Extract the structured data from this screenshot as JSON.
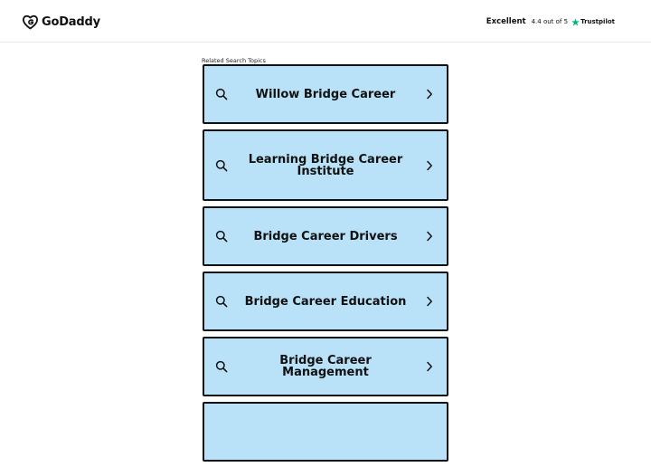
{
  "header": {
    "logo_text": "GoDaddy",
    "rating_word": "Excellent",
    "rating_score": "4.4 out of 5",
    "rating_provider": "Trustpilot",
    "star_color": "#00b67a"
  },
  "related": {
    "label": "Related Search Topics",
    "items": [
      {
        "label": "Willow Bridge Career"
      },
      {
        "label": "Learning Bridge Career Institute"
      },
      {
        "label": "Bridge Career Drivers"
      },
      {
        "label": "Bridge Career Education"
      },
      {
        "label": "Bridge Career Management"
      },
      {
        "label": ""
      }
    ]
  },
  "colors": {
    "card_background": "#b9e2f8",
    "card_border": "#111111"
  }
}
